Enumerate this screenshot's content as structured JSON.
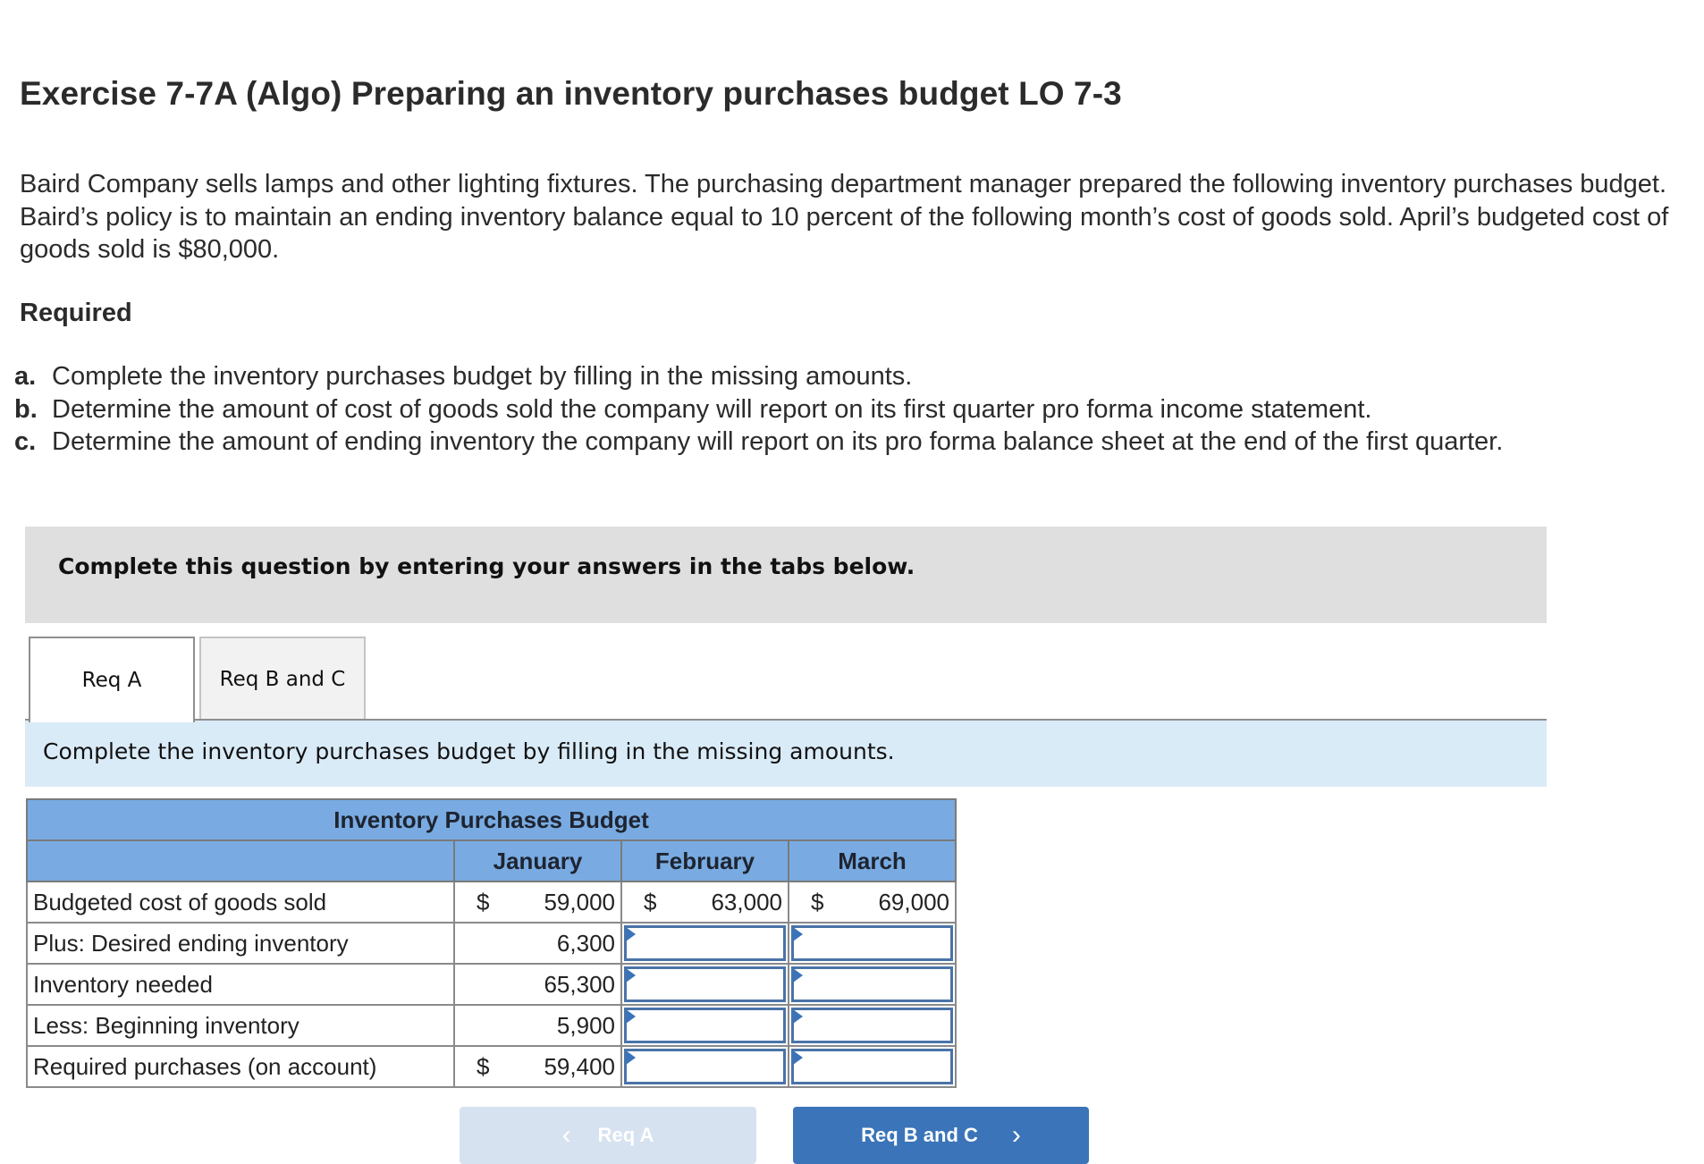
{
  "header": {
    "title": "Exercise 7-7A (Algo) Preparing an inventory purchases budget LO 7-3"
  },
  "intro": "Baird Company sells lamps and other lighting fixtures. The purchasing department manager prepared the following inventory purchases budget. Baird’s policy is to maintain an ending inventory balance equal to 10 percent of the following month’s cost of goods sold. April’s budgeted cost of goods sold is $80,000.",
  "required": {
    "heading": "Required",
    "items": [
      {
        "label": "a.",
        "text": "Complete the inventory purchases budget by filling in the missing amounts."
      },
      {
        "label": "b.",
        "text": "Determine the amount of cost of goods sold the company will report on its first quarter pro forma income statement."
      },
      {
        "label": "c.",
        "text": "Determine the amount of ending inventory the company will report on its pro forma balance sheet at the end of the first quarter."
      }
    ]
  },
  "banner": "Complete this question by entering your answers in the tabs below.",
  "tabs": [
    {
      "label": "Req A",
      "active": true
    },
    {
      "label": "Req B and C",
      "active": false
    }
  ],
  "instruction": "Complete the inventory purchases budget by filling in the missing amounts.",
  "table": {
    "title": "Inventory Purchases Budget",
    "columns": [
      "January",
      "February",
      "March"
    ],
    "currency_symbol": "$",
    "rows": [
      {
        "label": "Budgeted cost of goods sold",
        "cells": [
          {
            "dollar": true,
            "value": "59,000"
          },
          {
            "dollar": true,
            "value": "63,000"
          },
          {
            "dollar": true,
            "value": "69,000"
          }
        ]
      },
      {
        "label": "Plus: Desired ending inventory",
        "cells": [
          {
            "dollar": false,
            "value": "6,300"
          },
          {
            "input": true,
            "value": ""
          },
          {
            "input": true,
            "value": ""
          }
        ]
      },
      {
        "label": "Inventory needed",
        "cells": [
          {
            "dollar": false,
            "value": "65,300"
          },
          {
            "input": true,
            "value": ""
          },
          {
            "input": true,
            "value": ""
          }
        ]
      },
      {
        "label": "Less: Beginning inventory",
        "cells": [
          {
            "dollar": false,
            "value": "5,900"
          },
          {
            "input": true,
            "value": ""
          },
          {
            "input": true,
            "value": ""
          }
        ]
      },
      {
        "label": "Required purchases (on account)",
        "cells": [
          {
            "dollar": true,
            "value": "59,400"
          },
          {
            "input": true,
            "value": ""
          },
          {
            "input": true,
            "value": ""
          }
        ]
      }
    ]
  },
  "nav": {
    "prev_label": "Req A",
    "next_label": "Req B and C",
    "prev_icon": "chevron-left-icon",
    "next_icon": "chevron-right-icon"
  }
}
